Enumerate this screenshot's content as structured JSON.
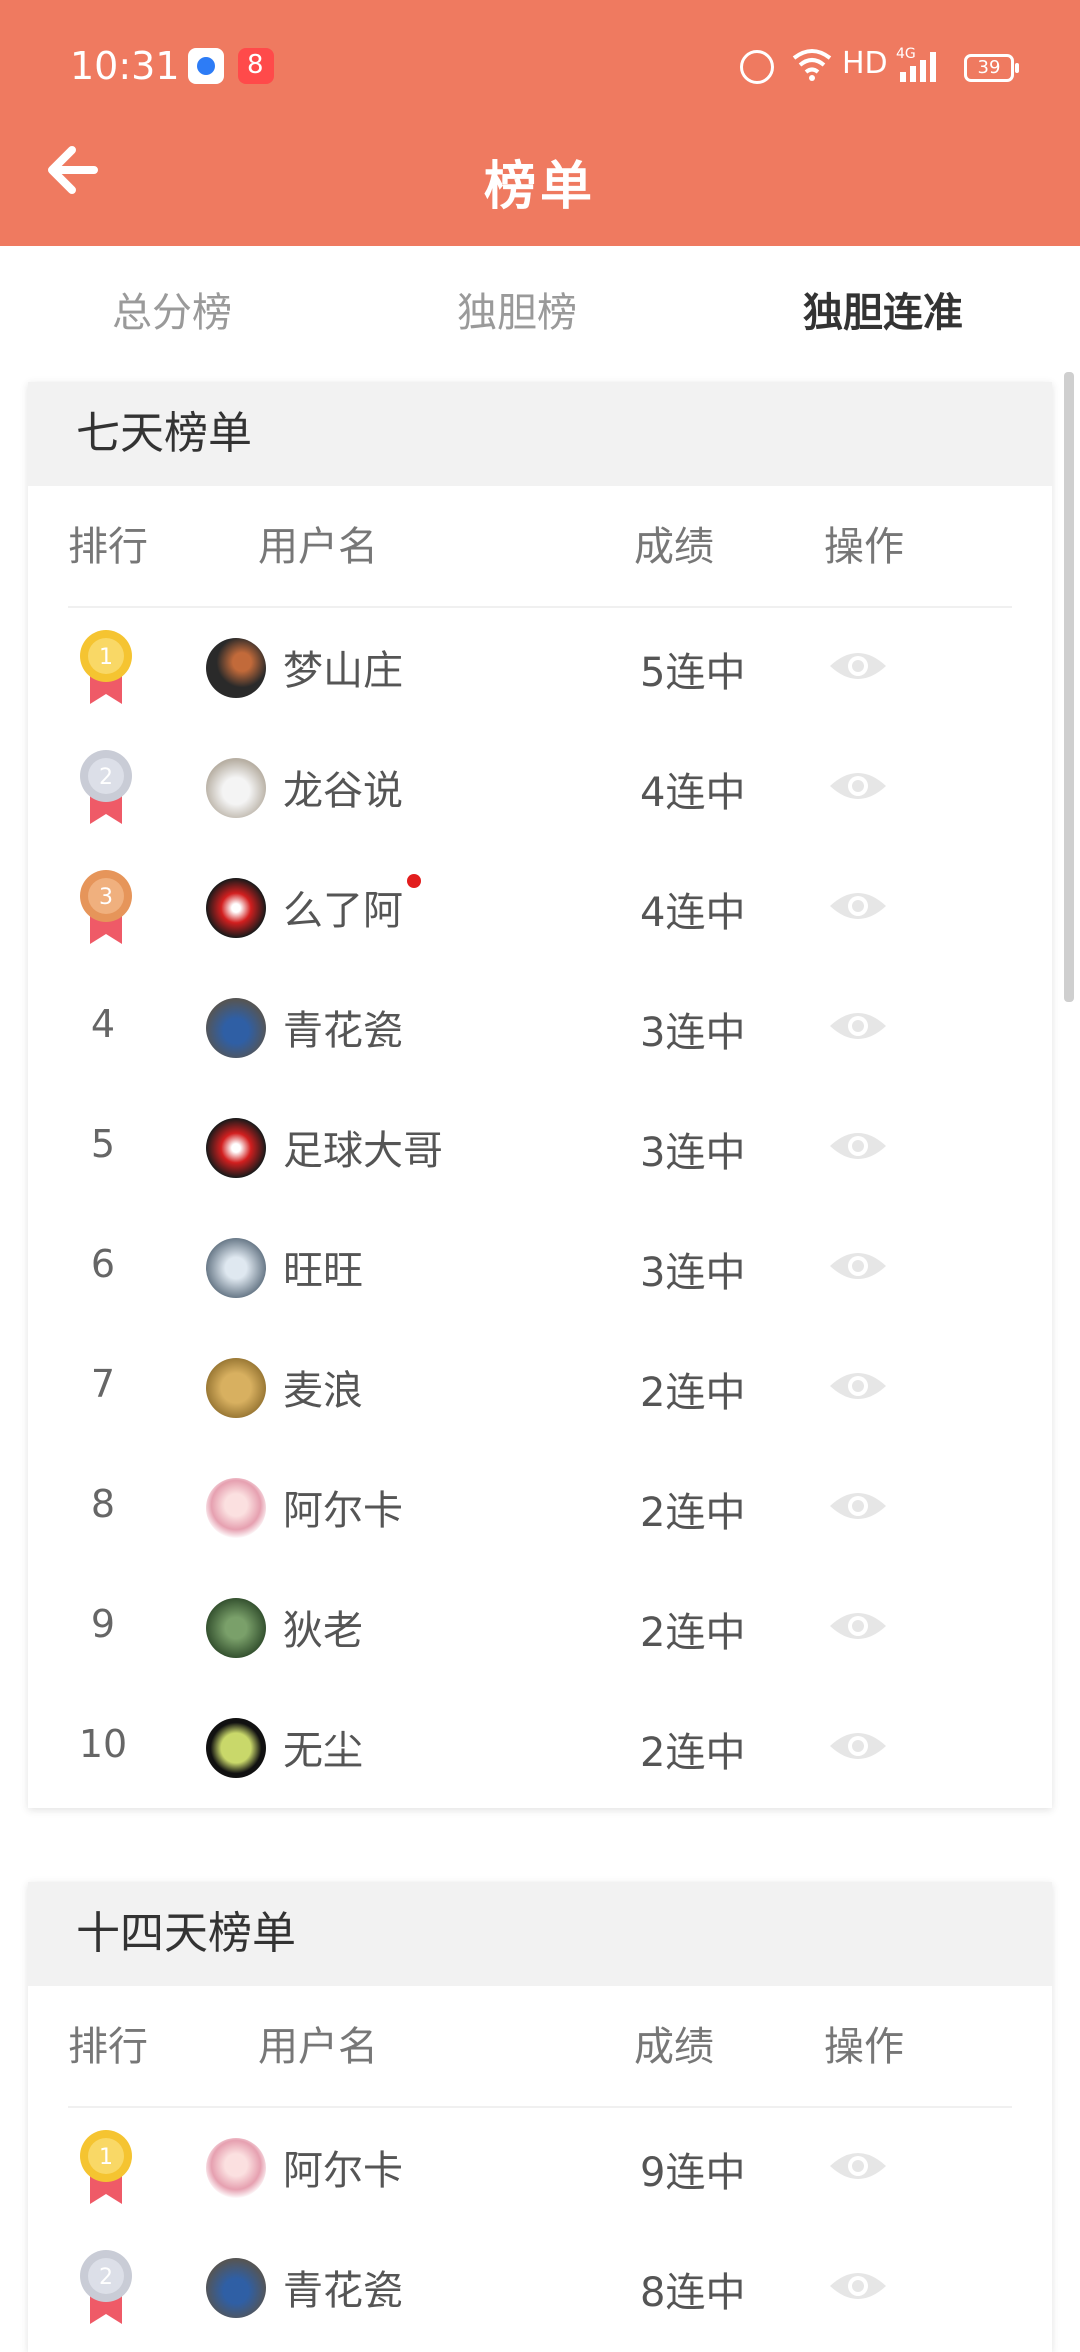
{
  "status_bar": {
    "time": "10:31",
    "network": "HD",
    "battery": "39",
    "icons": [
      "app-icon-blue",
      "app-icon-red",
      "alarm-icon",
      "wifi-icon",
      "signal-4g-icon",
      "battery-icon"
    ]
  },
  "header": {
    "title": "榜单",
    "back_icon": "arrow-left-icon"
  },
  "tabs": [
    {
      "label": "总分榜",
      "active": false
    },
    {
      "label": "独胆榜",
      "active": false
    },
    {
      "label": "独胆连准",
      "active": true
    }
  ],
  "columns": {
    "rank": "排行",
    "username": "用户名",
    "score": "成绩",
    "action": "操作"
  },
  "boards": [
    {
      "title": "七天榜单",
      "rows": [
        {
          "rank": "1",
          "name": "梦山庄",
          "score": "5连中",
          "medal": "gold"
        },
        {
          "rank": "2",
          "name": "龙谷说",
          "score": "4连中",
          "medal": "silver"
        },
        {
          "rank": "3",
          "name": "么了阿",
          "score": "4连中",
          "medal": "bronze",
          "new_dot": true
        },
        {
          "rank": "4",
          "name": "青花瓷",
          "score": "3连中"
        },
        {
          "rank": "5",
          "name": "足球大哥",
          "score": "3连中"
        },
        {
          "rank": "6",
          "name": "旺旺",
          "score": "3连中"
        },
        {
          "rank": "7",
          "name": "麦浪",
          "score": "2连中"
        },
        {
          "rank": "8",
          "name": "阿尔卡",
          "score": "2连中"
        },
        {
          "rank": "9",
          "name": "狄老",
          "score": "2连中"
        },
        {
          "rank": "10",
          "name": "无尘",
          "score": "2连中"
        }
      ]
    },
    {
      "title": "十四天榜单",
      "rows": [
        {
          "rank": "1",
          "name": "阿尔卡",
          "score": "9连中",
          "medal": "gold"
        },
        {
          "rank": "2",
          "name": "青花瓷",
          "score": "8连中",
          "medal": "silver"
        }
      ]
    }
  ],
  "colors": {
    "header_bg": "#ef7a60",
    "gold": "#f5c431",
    "silver": "#c9ccd6",
    "bronze": "#e6955a",
    "ribbon": "#ef5a67"
  }
}
